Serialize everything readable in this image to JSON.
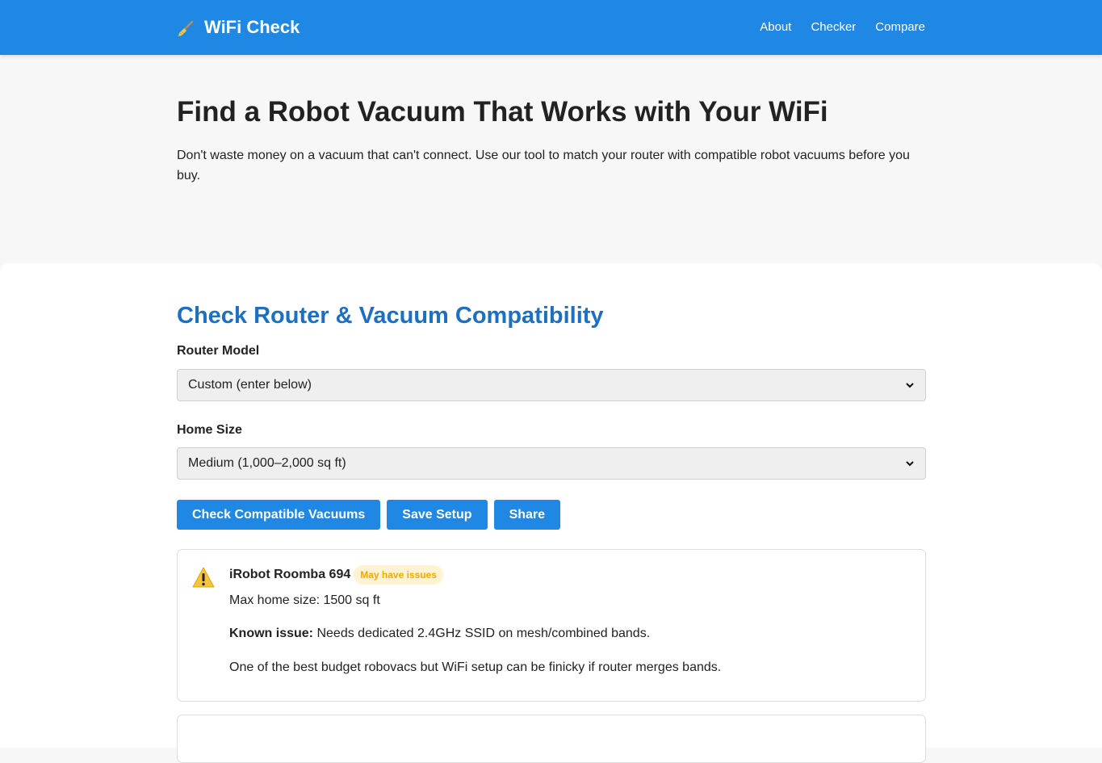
{
  "header": {
    "brand": "WiFi Check",
    "brand_icon": "broom-icon",
    "nav": [
      "About",
      "Checker",
      "Compare"
    ]
  },
  "hero": {
    "title": "Find a Robot Vacuum That Works with Your WiFi",
    "subtitle": "Don't waste money on a vacuum that can't connect. Use our tool to match your router with compatible robot vacuums before you buy."
  },
  "checker": {
    "title": "Check Router & Vacuum Compatibility",
    "router_label": "Router Model",
    "router_value": "Custom (enter below)",
    "home_label": "Home Size",
    "home_value": "Medium (1,000–2,000 sq ft)",
    "buttons": [
      "Check Compatible Vacuums",
      "Save Setup",
      "Share"
    ]
  },
  "results": [
    {
      "icon": "warning-icon",
      "name": "iRobot Roomba 694",
      "badge": "May have issues",
      "max_size": "Max home size: 1500 sq ft",
      "issue_label": "Known issue:",
      "issue_text": "Needs dedicated 2.4GHz SSID on mesh/combined bands.",
      "note": "One of the best budget robovacs but WiFi setup can be finicky if router merges bands."
    }
  ],
  "colors": {
    "primary": "#1f88e5",
    "heading_blue": "#1d6fc2",
    "badge_text": "#f2a900",
    "badge_bg": "#fff3d1"
  }
}
